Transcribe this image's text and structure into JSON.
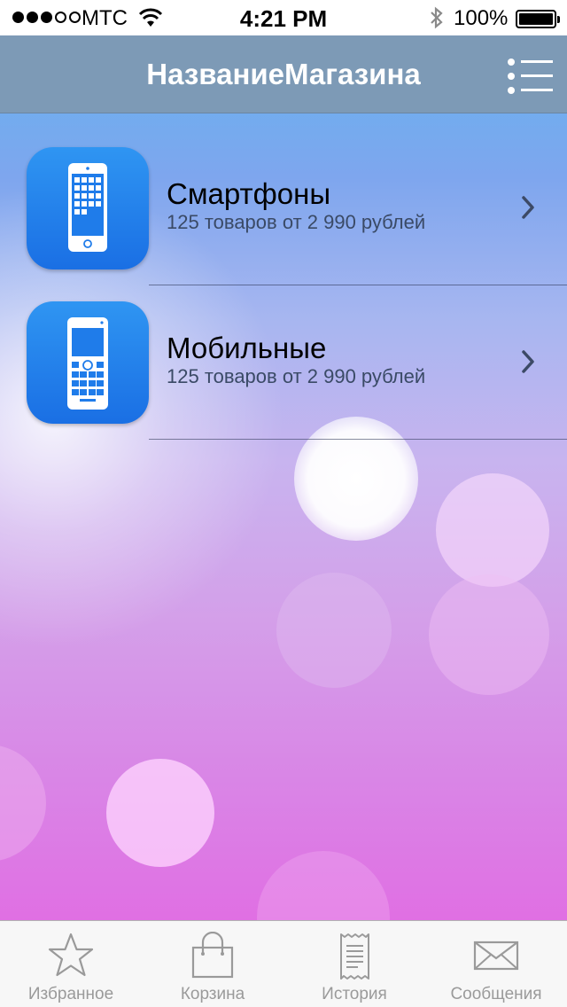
{
  "status_bar": {
    "carrier": "МТС",
    "time": "4:21 PM",
    "battery": "100%"
  },
  "nav": {
    "title": "НазваниеМагазина",
    "menu_icon": "list-menu-icon"
  },
  "categories": [
    {
      "title": "Смартфоны",
      "subtitle": "125 товаров от 2 990 рублей",
      "icon": "smartphone-icon"
    },
    {
      "title": "Мобильные",
      "subtitle": "125 товаров от 2 990 рублей",
      "icon": "mobile-phone-icon"
    }
  ],
  "tabs": [
    {
      "label": "Избранное",
      "icon": "star-icon"
    },
    {
      "label": "Корзина",
      "icon": "bag-icon"
    },
    {
      "label": "История",
      "icon": "receipt-icon"
    },
    {
      "label": "Сообщения",
      "icon": "envelope-icon"
    }
  ],
  "colors": {
    "nav_bar": "#7d9ab6",
    "icon_tile": "#1f7cea",
    "tab_inactive": "#9a9a9a"
  }
}
